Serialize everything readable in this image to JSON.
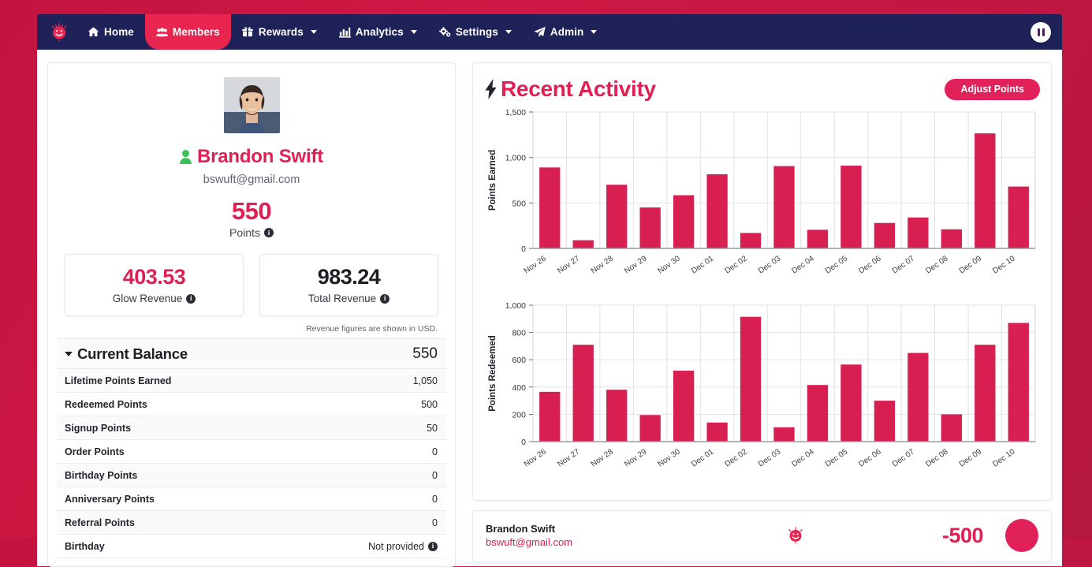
{
  "theme": {
    "brand_pink": "#e01f52",
    "nav_navy": "#1f2259",
    "bar_color": "#d81f52",
    "page_bg": "#c4133f"
  },
  "navbar": {
    "logo_name": "glow-balloon-logo",
    "items": [
      {
        "label": "Home",
        "icon": "home-icon",
        "caret": false,
        "active": false
      },
      {
        "label": "Members",
        "icon": "members-icon",
        "caret": false,
        "active": true
      },
      {
        "label": "Rewards",
        "icon": "gift-icon",
        "caret": true,
        "active": false
      },
      {
        "label": "Analytics",
        "icon": "bar-chart-icon",
        "caret": true,
        "active": false
      },
      {
        "label": "Settings",
        "icon": "gears-icon",
        "caret": true,
        "active": false
      },
      {
        "label": "Admin",
        "icon": "paper-plane-icon",
        "caret": true,
        "active": false
      }
    ],
    "pause_button": "pause-icon"
  },
  "profile": {
    "avatar_alt": "member-photo",
    "name": "Brandon Swift",
    "email": "bswuft@gmail.com",
    "points_value": "550",
    "points_label": "Points",
    "revenue_cards": [
      {
        "value": "403.53",
        "label": "Glow Revenue",
        "color": "pink"
      },
      {
        "value": "983.24",
        "label": "Total Revenue",
        "color": "dark"
      }
    ],
    "usd_note": "Revenue figures are shown in USD."
  },
  "balance": {
    "header_label": "Current Balance",
    "header_value": "550",
    "rows": [
      {
        "label": "Lifetime Points Earned",
        "value": "1,050",
        "info": false
      },
      {
        "label": "Redeemed Points",
        "value": "500",
        "info": false
      },
      {
        "label": "Signup Points",
        "value": "50",
        "info": false
      },
      {
        "label": "Order Points",
        "value": "0",
        "info": false
      },
      {
        "label": "Birthday Points",
        "value": "0",
        "info": false
      },
      {
        "label": "Anniversary Points",
        "value": "0",
        "info": false
      },
      {
        "label": "Referral Points",
        "value": "0",
        "info": false
      },
      {
        "label": "Birthday",
        "value": "Not provided",
        "info": true
      }
    ]
  },
  "activity": {
    "title": "Recent Activity",
    "icon": "bolt-icon",
    "adjust_button": "Adjust Points"
  },
  "feed": [
    {
      "name": "Brandon Swift",
      "email": "bswuft@gmail.com",
      "delta": "-500",
      "logo": "glow-balloon-logo",
      "avatar": "member-avatar"
    }
  ],
  "chart_data": [
    {
      "type": "bar",
      "title": "",
      "ylabel": "Points Earned",
      "xlabel": "",
      "ylim": [
        0,
        1500
      ],
      "yticks": [
        0,
        500,
        1000,
        1500
      ],
      "ytick_labels": [
        "0",
        "500",
        "1,000",
        "1,500"
      ],
      "grid": true,
      "categories": [
        "Nov 26",
        "Nov 27",
        "Nov 28",
        "Nov 29",
        "Nov 30",
        "Dec 01",
        "Dec 02",
        "Dec 03",
        "Dec 04",
        "Dec 05",
        "Dec 06",
        "Dec 07",
        "Dec 08",
        "Dec 09",
        "Dec 10"
      ],
      "values": [
        890,
        90,
        700,
        450,
        585,
        815,
        170,
        905,
        205,
        910,
        280,
        340,
        210,
        1265,
        680
      ]
    },
    {
      "type": "bar",
      "title": "",
      "ylabel": "Points Redeemed",
      "xlabel": "",
      "ylim": [
        0,
        1000
      ],
      "yticks": [
        0,
        200,
        400,
        600,
        800,
        1000
      ],
      "ytick_labels": [
        "0",
        "200",
        "400",
        "600",
        "800",
        "1,000"
      ],
      "grid": true,
      "categories": [
        "Nov 26",
        "Nov 27",
        "Nov 28",
        "Nov 29",
        "Nov 30",
        "Dec 01",
        "Dec 02",
        "Dec 03",
        "Dec 04",
        "Dec 05",
        "Dec 06",
        "Dec 07",
        "Dec 08",
        "Dec 09",
        "Dec 10"
      ],
      "values": [
        365,
        710,
        380,
        195,
        520,
        140,
        915,
        105,
        415,
        565,
        300,
        650,
        200,
        710,
        870
      ]
    }
  ]
}
